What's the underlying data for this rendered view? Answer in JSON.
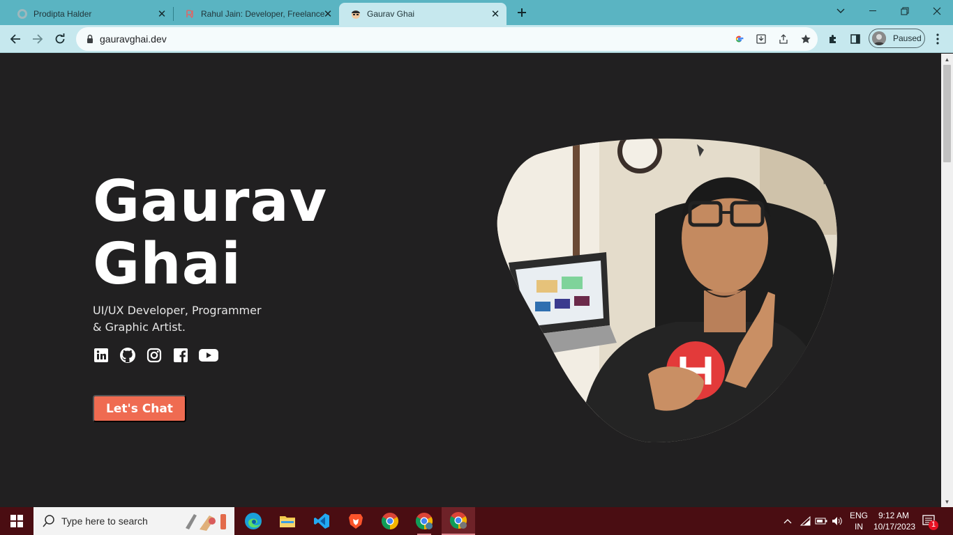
{
  "browser": {
    "tabs": [
      {
        "title": "Prodipta Halder",
        "favicon": "globe-icon"
      },
      {
        "title": "Rahul Jain: Developer, Freelance",
        "favicon": "rj-logo-icon"
      },
      {
        "title": "Gaurav Ghai",
        "favicon": "avatar-face-icon"
      }
    ],
    "address": "gauravghai.dev",
    "profile_status": "Paused"
  },
  "page": {
    "name_line1": "Gaurav",
    "name_line2": "Ghai",
    "tagline_line1": "UI/UX Developer, Programmer",
    "tagline_line2": "& Graphic Artist.",
    "socials": [
      "linkedin-icon",
      "github-icon",
      "instagram-icon",
      "facebook-icon",
      "youtube-icon"
    ],
    "cta_label": "Let's Chat",
    "accent": "#ef6b51",
    "background": "#212021"
  },
  "taskbar": {
    "search_placeholder": "Type here to search",
    "lang_line1": "ENG",
    "lang_line2": "IN",
    "time": "9:12 AM",
    "date": "10/17/2023",
    "notification_count": "1"
  }
}
